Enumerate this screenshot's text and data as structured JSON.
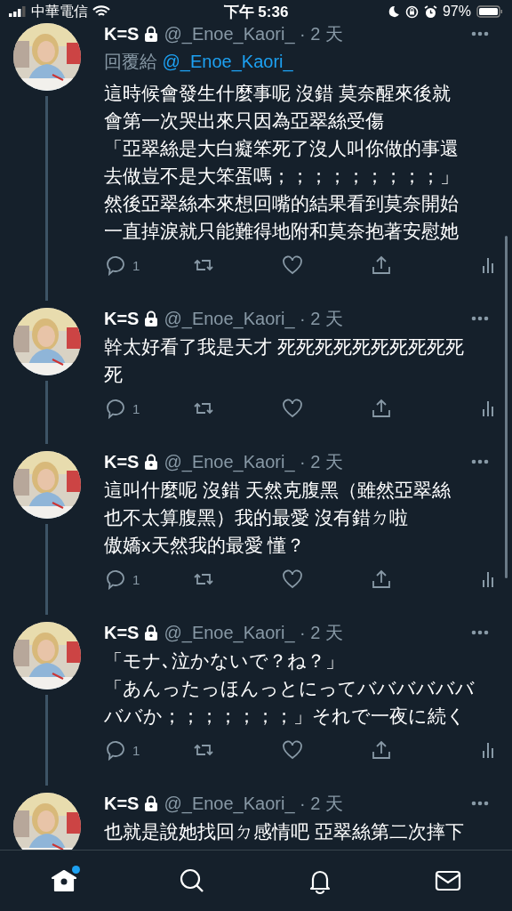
{
  "status_bar": {
    "carrier": "中華電信",
    "time": "下午 5:36",
    "battery": "97%"
  },
  "tweets": [
    {
      "name": "K=S",
      "meta": "@_Enoe_Kaori_ · 2 天",
      "reply_label": "回覆給",
      "reply_handle": "@_Enoe_Kaori_",
      "lines": [
        "這時候會發生什麼事呢 沒錯 莫奈醒來後就",
        "會第一次哭出來只因為亞翠絲受傷",
        "「亞翠絲是大白癡笨死了沒人叫你做的事還",
        "去做豈不是大笨蛋嗎；；；；；；；；；」",
        "然後亞翠絲本來想回嘴的結果看到莫奈開始",
        "一直掉淚就只能難得地附和莫奈抱著安慰她"
      ],
      "replies": "1"
    },
    {
      "name": "K=S",
      "meta": "@_Enoe_Kaori_ · 2 天",
      "lines": [
        "幹太好看了我是天才 死死死死死死死死死死",
        "死"
      ],
      "replies": "1"
    },
    {
      "name": "K=S",
      "meta": "@_Enoe_Kaori_ · 2 天",
      "lines": [
        "這叫什麼呢 沒錯 天然克腹黑（雖然亞翠絲",
        "也不太算腹黑）我的最愛 沒有錯ㄉ啦",
        "傲嬌x天然我的最愛 懂？"
      ],
      "replies": "1"
    },
    {
      "name": "K=S",
      "meta": "@_Enoe_Kaori_ · 2 天",
      "lines": [
        "「モナ､泣かないで？ね？」",
        "「あんったっほんっとにってババババババ",
        "ババか；；；；；；；」それで一夜に続く"
      ],
      "replies": "1"
    },
    {
      "name": "K=S",
      "meta": "@_Enoe_Kaori_ · 2 天",
      "lines": [
        "也就是說她找回ㄉ感情吧 亞翠絲第二次摔下"
      ]
    }
  ],
  "tab_bar": [
    {
      "kind": "home",
      "selected": true,
      "unread": true
    },
    {
      "kind": "search",
      "selected": false,
      "unread": false
    },
    {
      "kind": "notifications",
      "selected": false,
      "unread": false
    },
    {
      "kind": "messages",
      "selected": false,
      "unread": false
    }
  ]
}
